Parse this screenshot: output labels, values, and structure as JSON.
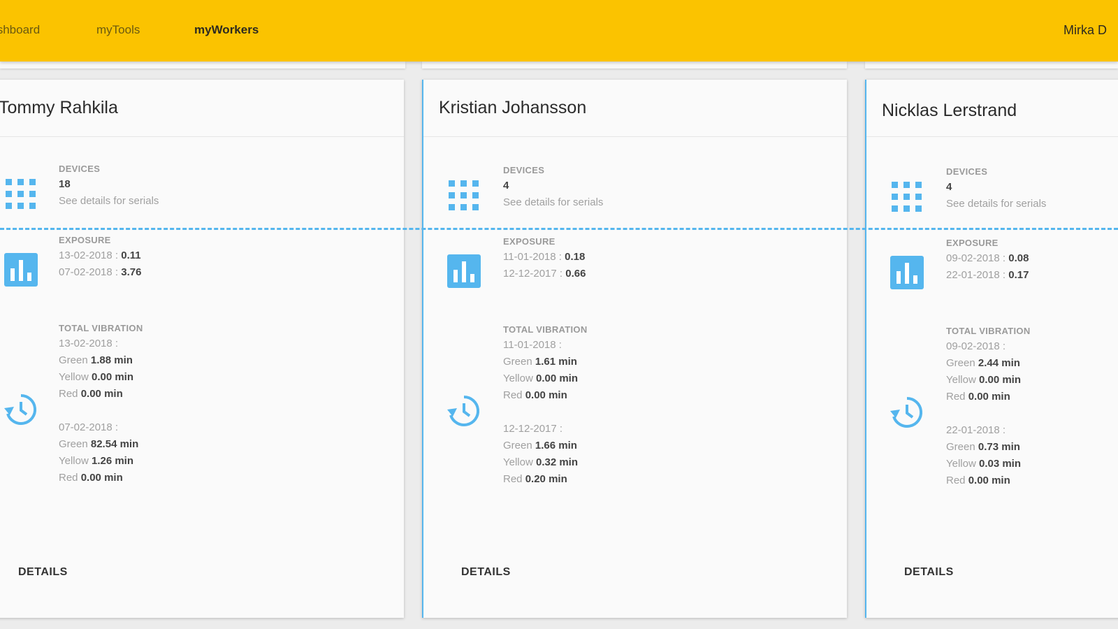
{
  "nav": {
    "items": [
      {
        "label": "Dashboard",
        "active": false
      },
      {
        "label": "myTools",
        "active": false
      },
      {
        "label": "myWorkers",
        "active": true
      }
    ],
    "user": "Mirka D"
  },
  "colors": {
    "topbar": "#fbc300",
    "accent": "#55b6ee"
  },
  "workers": [
    {
      "name": "Tommy Rahkila",
      "devices_label": "DEVICES",
      "devices_count": "18",
      "devices_hint": "See details for serials",
      "exposure_label": "EXPOSURE",
      "exposure": [
        {
          "date": "13-02-2018 :",
          "value": "0.11"
        },
        {
          "date": "07-02-2018 :",
          "value": "3.76"
        }
      ],
      "vibration_label": "TOTAL VIBRATION",
      "vibration": [
        {
          "date": "13-02-2018 :",
          "green": "1.88 min",
          "yellow": "0.00 min",
          "red": "0.00 min"
        },
        {
          "date": "07-02-2018 :",
          "green": "82.54 min",
          "yellow": "1.26 min",
          "red": "0.00 min"
        }
      ],
      "details_label": "DETAILS"
    },
    {
      "name": "Kristian Johansson",
      "devices_label": "DEVICES",
      "devices_count": "4",
      "devices_hint": "See details for serials",
      "exposure_label": "EXPOSURE",
      "exposure": [
        {
          "date": "11-01-2018 :",
          "value": "0.18"
        },
        {
          "date": "12-12-2017 :",
          "value": "0.66"
        }
      ],
      "vibration_label": "TOTAL VIBRATION",
      "vibration": [
        {
          "date": "11-01-2018 :",
          "green": "1.61 min",
          "yellow": "0.00 min",
          "red": "0.00 min"
        },
        {
          "date": "12-12-2017 :",
          "green": "1.66 min",
          "yellow": "0.32 min",
          "red": "0.20 min"
        }
      ],
      "details_label": "DETAILS"
    },
    {
      "name": "Nicklas Lerstrand",
      "devices_label": "DEVICES",
      "devices_count": "4",
      "devices_hint": "See details for serials",
      "exposure_label": "EXPOSURE",
      "exposure": [
        {
          "date": "09-02-2018 :",
          "value": "0.08"
        },
        {
          "date": "22-01-2018 :",
          "value": "0.17"
        }
      ],
      "vibration_label": "TOTAL VIBRATION",
      "vibration": [
        {
          "date": "09-02-2018 :",
          "green": "2.44 min",
          "yellow": "0.00 min",
          "red": "0.00 min"
        },
        {
          "date": "22-01-2018 :",
          "green": "0.73 min",
          "yellow": "0.03 min",
          "red": "0.00 min"
        }
      ],
      "details_label": "DETAILS"
    }
  ],
  "labels": {
    "green": "Green",
    "yellow": "Yellow",
    "red": "Red"
  },
  "icons": {
    "devices": "grid-icon",
    "exposure": "bar-chart-icon",
    "vibration": "history-icon"
  }
}
